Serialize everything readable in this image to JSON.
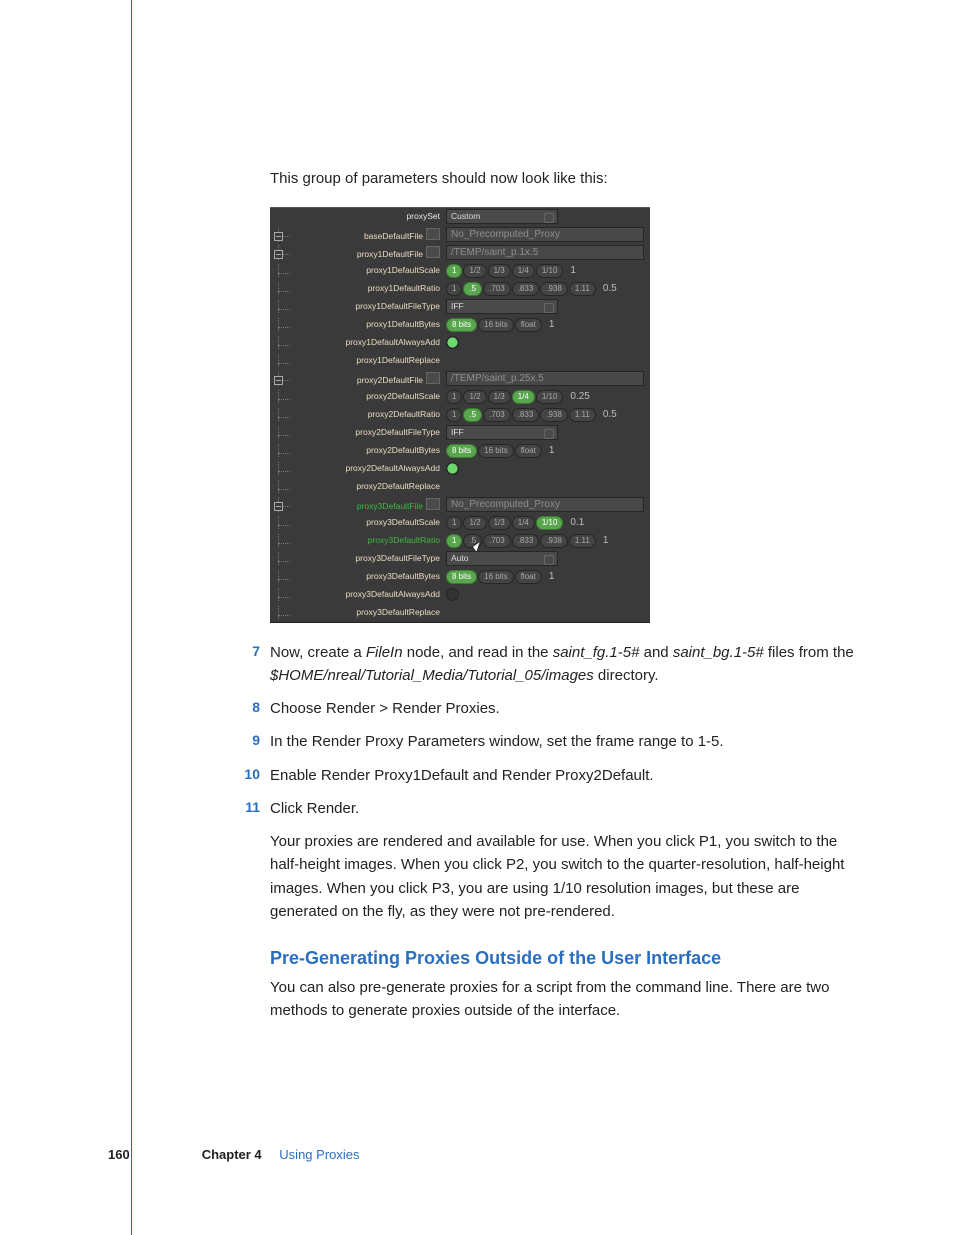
{
  "intro": "This group of parameters should now look like this:",
  "ui": {
    "rows": [
      {
        "kind": "dd",
        "label": "proxySet",
        "value": "Custom",
        "box": false
      },
      {
        "kind": "file",
        "label": "baseDefaultFile",
        "value": "No_Precomputed_Proxy",
        "box": true
      },
      {
        "kind": "file",
        "label": "proxy1DefaultFile",
        "value": "/TEMP/saint_p.1x.5",
        "box": true
      },
      {
        "kind": "pills",
        "label": "proxy1DefaultScale",
        "opts": [
          "1",
          "1/2",
          "1/3",
          "1/4",
          "1/10"
        ],
        "sel": 0,
        "num": "1"
      },
      {
        "kind": "pills",
        "label": "proxy1DefaultRatio",
        "opts": [
          "1",
          ".5",
          ".703",
          ".833",
          ".938",
          "1.11"
        ],
        "sel": 1,
        "num": "0.5"
      },
      {
        "kind": "dd",
        "label": "proxy1DefaultFileType",
        "value": "IFF"
      },
      {
        "kind": "pills",
        "label": "proxy1DefaultBytes",
        "opts": [
          "8 bits",
          "16 bits",
          "float"
        ],
        "sel": 0,
        "num": "1"
      },
      {
        "kind": "radio",
        "label": "proxy1DefaultAlwaysAdd",
        "on": true
      },
      {
        "kind": "blank",
        "label": "proxy1DefaultReplace"
      },
      {
        "kind": "file",
        "label": "proxy2DefaultFile",
        "value": "/TEMP/saint_p.25x.5",
        "box": true
      },
      {
        "kind": "pills",
        "label": "proxy2DefaultScale",
        "opts": [
          "1",
          "1/2",
          "1/3",
          "1/4",
          "1/10"
        ],
        "sel": 3,
        "num": "0.25"
      },
      {
        "kind": "pills",
        "label": "proxy2DefaultRatio",
        "opts": [
          "1",
          ".5",
          ".703",
          ".833",
          ".938",
          "1.11"
        ],
        "sel": 1,
        "num": "0.5"
      },
      {
        "kind": "dd",
        "label": "proxy2DefaultFileType",
        "value": "IFF"
      },
      {
        "kind": "pills",
        "label": "proxy2DefaultBytes",
        "opts": [
          "8 bits",
          "16 bits",
          "float"
        ],
        "sel": 0,
        "num": "1"
      },
      {
        "kind": "radio",
        "label": "proxy2DefaultAlwaysAdd",
        "on": true
      },
      {
        "kind": "blank",
        "label": "proxy2DefaultReplace"
      },
      {
        "kind": "file",
        "label": "proxy3DefaultFile",
        "value": "No_Precomputed_Proxy",
        "box": true,
        "green": true
      },
      {
        "kind": "pills",
        "label": "proxy3DefaultScale",
        "opts": [
          "1",
          "1/2",
          "1/3",
          "1/4",
          "1/10"
        ],
        "sel": 4,
        "num": "0.1"
      },
      {
        "kind": "pills",
        "label": "proxy3DefaultRatio",
        "opts": [
          "1",
          ".5",
          ".703",
          ".833",
          ".938",
          "1.11"
        ],
        "sel": 0,
        "num": "1",
        "green": true,
        "cursor": true
      },
      {
        "kind": "dd",
        "label": "proxy3DefaultFileType",
        "value": "Auto"
      },
      {
        "kind": "pills",
        "label": "proxy3DefaultBytes",
        "opts": [
          "8 bits",
          "16 bits",
          "float"
        ],
        "sel": 0,
        "num": "1"
      },
      {
        "kind": "radio",
        "label": "proxy3DefaultAlwaysAdd",
        "on": false
      },
      {
        "kind": "blank",
        "label": "proxy3DefaultReplace"
      }
    ]
  },
  "steps": [
    {
      "n": "7",
      "html": "Now, create a <em>FileIn</em> node, and read in the <em>saint_fg.1-5#</em> and <em>saint_bg.1-5#</em> files from the <em>$HOME/nreal/Tutorial_Media/Tutorial_05/images</em> directory."
    },
    {
      "n": "8",
      "html": "Choose Render > Render Proxies."
    },
    {
      "n": "9",
      "html": "In the Render Proxy Parameters window, set the frame range to 1-5."
    },
    {
      "n": "10",
      "html": "Enable Render Proxy1Default and Render Proxy2Default."
    },
    {
      "n": "11",
      "html": "Click Render."
    }
  ],
  "result_paragraph": "Your proxies are rendered and available for use. When you click P1, you switch to the half-height images. When you click P2, you switch to the quarter-resolution, half-height images. When you click P3, you are using 1/10 resolution images, but these are generated on the fly, as they were not pre-rendered.",
  "subhead": "Pre-Generating Proxies Outside of the User Interface",
  "sub_para": "You can also pre-generate proxies for a script from the command line. There are two methods to generate proxies outside of the interface.",
  "footer": {
    "page": "160",
    "chapter": "Chapter 4",
    "title": "Using Proxies"
  }
}
